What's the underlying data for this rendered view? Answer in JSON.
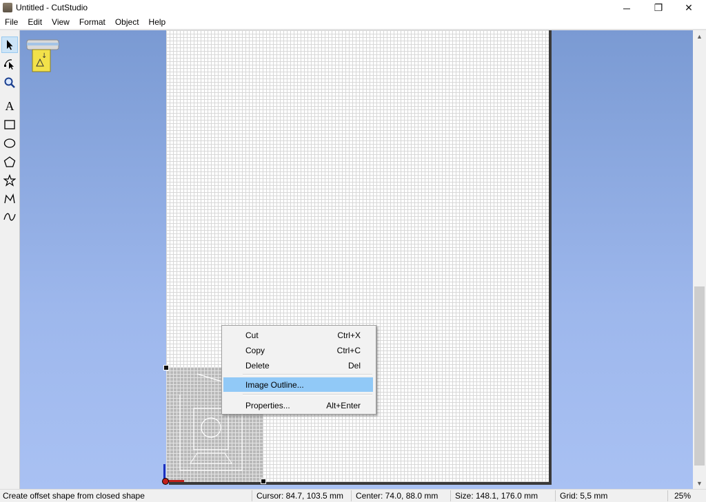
{
  "window": {
    "title": "Untitled - CutStudio",
    "minimize_glyph": "─",
    "maximize_glyph": "❐",
    "close_glyph": "✕"
  },
  "menubar": {
    "items": [
      "File",
      "Edit",
      "View",
      "Format",
      "Object",
      "Help"
    ]
  },
  "toolbar": {
    "tools": [
      {
        "name": "select",
        "icon": "arrow-pointer-icon",
        "active": true
      },
      {
        "name": "edit-points",
        "icon": "node-edit-icon",
        "active": false
      },
      {
        "name": "zoom",
        "icon": "magnifier-icon",
        "active": false
      },
      {
        "name": "text",
        "icon": "text-icon",
        "label": "A",
        "active": false
      },
      {
        "name": "rectangle",
        "icon": "rectangle-icon",
        "active": false
      },
      {
        "name": "ellipse",
        "icon": "ellipse-icon",
        "active": false
      },
      {
        "name": "polygon",
        "icon": "pentagon-icon",
        "active": false
      },
      {
        "name": "star",
        "icon": "star-icon",
        "active": false
      },
      {
        "name": "polyline",
        "icon": "polyline-icon",
        "active": false
      },
      {
        "name": "curve",
        "icon": "curve-icon",
        "active": false
      }
    ]
  },
  "context_menu": {
    "items": [
      {
        "label": "Cut",
        "shortcut": "Ctrl+X"
      },
      {
        "label": "Copy",
        "shortcut": "Ctrl+C"
      },
      {
        "label": "Delete",
        "shortcut": "Del"
      },
      {
        "label": "Image Outline...",
        "shortcut": "",
        "highlighted": true
      },
      {
        "label": "Properties...",
        "shortcut": "Alt+Enter"
      }
    ]
  },
  "statusbar": {
    "hint": "Create offset shape from closed shape",
    "cursor": "Cursor: 84.7, 103.5 mm",
    "center": "Center: 74.0, 88.0 mm",
    "size": "Size: 148.1, 176.0 mm",
    "grid": "Grid: 5,5 mm",
    "zoom": "25%"
  },
  "colors": {
    "canvas_top": "#7a9ad3",
    "canvas_bottom": "#a9c1f3",
    "menu_highlight": "#91c9f7",
    "active_tool": "#cce4f7"
  }
}
